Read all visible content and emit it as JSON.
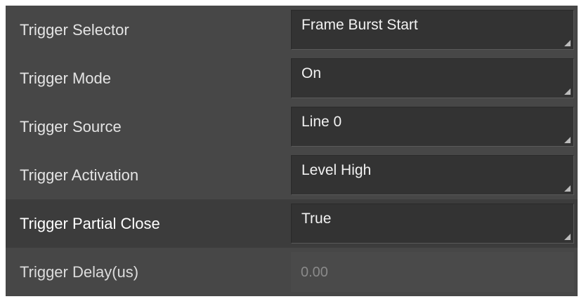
{
  "parameters": [
    {
      "label": "Trigger Selector",
      "value": "Frame Burst Start",
      "arrow_icon": "dropdown-corner-icon"
    },
    {
      "label": "Trigger Mode",
      "value": "On",
      "arrow_icon": "dropdown-corner-icon"
    },
    {
      "label": "Trigger Source",
      "value": "Line 0",
      "arrow_icon": "dropdown-corner-icon"
    },
    {
      "label": "Trigger Activation",
      "value": "Level High",
      "arrow_icon": "dropdown-corner-icon"
    },
    {
      "label": "Trigger Partial Close",
      "value": "True",
      "arrow_icon": "dropdown-corner-icon"
    },
    {
      "label": "Trigger Delay(us)",
      "value": "0.00"
    }
  ],
  "colors": {
    "panel_bg": "#474747",
    "active_row_bg": "#3c3c3c",
    "combo_bg": "#333333",
    "disabled_text": "#8a8a8a"
  }
}
